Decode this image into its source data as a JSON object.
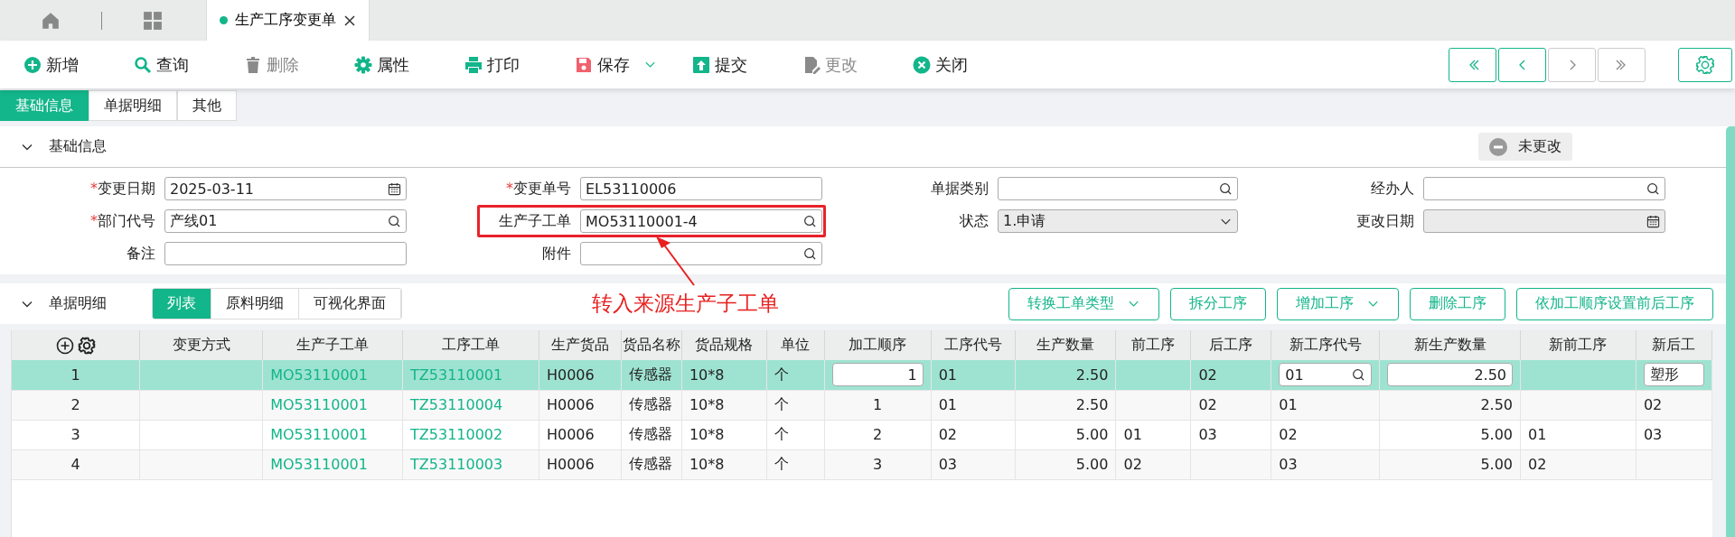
{
  "window_tabs": [
    {
      "kind": "home",
      "selected": false
    },
    {
      "kind": "apps",
      "selected": false
    },
    {
      "kind": "page",
      "label": "生产工序变更单",
      "selected": true,
      "closable": true
    }
  ],
  "toolbar": {
    "buttons": [
      {
        "label": "新增",
        "kind": "add",
        "disabled": false
      },
      {
        "label": "查询",
        "kind": "search",
        "disabled": false
      },
      {
        "label": "删除",
        "kind": "delete",
        "disabled": true
      },
      {
        "label": "属性",
        "kind": "gear",
        "disabled": false
      },
      {
        "label": "打印",
        "kind": "print",
        "disabled": false
      },
      {
        "label": "保存",
        "kind": "save",
        "disabled": false,
        "dropdown": true
      },
      {
        "label": "提交",
        "kind": "submit",
        "disabled": false
      },
      {
        "label": "更改",
        "kind": "edit",
        "disabled": true
      },
      {
        "label": "关闭",
        "kind": "close",
        "disabled": false
      }
    ],
    "nav": [
      {
        "kind": "first",
        "disabled": false
      },
      {
        "kind": "prev",
        "disabled": false
      },
      {
        "kind": "next",
        "disabled": true
      },
      {
        "kind": "last",
        "disabled": true
      }
    ]
  },
  "form_tabs": [
    {
      "label": "基础信息",
      "selected": true
    },
    {
      "label": "单据明细",
      "selected": false
    },
    {
      "label": "其他",
      "selected": false
    }
  ],
  "basic_section": {
    "title": "基础信息",
    "expanded": true,
    "status_badge": "未更改",
    "rows": [
      [
        {
          "required_mark": "*",
          "label": "变更日期",
          "kind": "date",
          "value": "2025-03-11"
        },
        {
          "required_mark": "*",
          "label": "变更单号",
          "kind": "text",
          "value": "EL53110006"
        },
        {
          "label": "单据类别",
          "kind": "lookup"
        },
        {
          "label": "经办人",
          "kind": "lookup"
        }
      ],
      [
        {
          "required_mark": "*",
          "label": "部门代号",
          "kind": "lookup",
          "value": "产线01"
        },
        {
          "label": "生产子工单",
          "kind": "lookup",
          "value": "MO53110001-4",
          "highlighted": true
        },
        {
          "label": "状态",
          "kind": "select",
          "value": "1.申请"
        },
        {
          "label": "更改日期",
          "kind": "date",
          "disabled": true
        }
      ],
      [
        {
          "label": "备注",
          "kind": "memo"
        },
        {
          "label": "附件",
          "kind": "lookup"
        }
      ]
    ]
  },
  "annotation": {
    "text": "转入来源生产子工单"
  },
  "detail_section": {
    "title": "单据明细",
    "expanded": true,
    "views": [
      {
        "label": "列表",
        "selected": true
      },
      {
        "label": "原料明细",
        "selected": false
      },
      {
        "label": "可视化界面",
        "selected": false
      }
    ],
    "actions": [
      {
        "label": "转换工单类型",
        "dropdown": true
      },
      {
        "label": "拆分工序",
        "dropdown": false
      },
      {
        "label": "增加工序",
        "dropdown": true
      },
      {
        "label": "删除工序",
        "dropdown": false
      },
      {
        "label": "依加工顺序设置前后工序",
        "dropdown": false
      }
    ]
  },
  "table": {
    "columns": [
      {
        "kind": "index"
      },
      {
        "label": "变更方式",
        "kind": "text"
      },
      {
        "label": "生产子工单",
        "kind": "link"
      },
      {
        "label": "工序工单",
        "kind": "link"
      },
      {
        "label": "生产货品",
        "kind": "text"
      },
      {
        "label": "货品名称",
        "kind": "text"
      },
      {
        "label": "货品规格",
        "kind": "text"
      },
      {
        "label": "单位",
        "kind": "text"
      },
      {
        "label": "加工顺序",
        "kind": "center",
        "editable": true
      },
      {
        "label": "工序代号",
        "kind": "text"
      },
      {
        "label": "生产数量",
        "kind": "number"
      },
      {
        "label": "前工序",
        "kind": "text"
      },
      {
        "label": "后工序",
        "kind": "text"
      },
      {
        "label": "新工序代号",
        "kind": "lookup",
        "editable": true
      },
      {
        "label": "新生产数量",
        "kind": "number",
        "editable": true
      },
      {
        "label": "新前工序",
        "kind": "text"
      },
      {
        "label": "新后工",
        "kind": "text",
        "editable": true
      }
    ],
    "rows": [
      {
        "selected": true,
        "cells": [
          "1",
          null,
          "MO53110001",
          "TZ53110001",
          "H0006",
          "传感器",
          "10*8",
          "个",
          "1",
          "01",
          "2.50",
          null,
          "02",
          "01",
          "2.50",
          null,
          "塑形"
        ]
      },
      {
        "selected": false,
        "cells": [
          "2",
          null,
          "MO53110001",
          "TZ53110004",
          "H0006",
          "传感器",
          "10*8",
          "个",
          "1",
          "01",
          "2.50",
          null,
          "02",
          "01",
          "2.50",
          null,
          "02"
        ]
      },
      {
        "selected": false,
        "cells": [
          "3",
          null,
          "MO53110001",
          "TZ53110002",
          "H0006",
          "传感器",
          "10*8",
          "个",
          "2",
          "02",
          "5.00",
          "01",
          "03",
          "02",
          "5.00",
          "01",
          "03"
        ]
      },
      {
        "selected": false,
        "cells": [
          "4",
          null,
          "MO53110001",
          "TZ53110003",
          "H0006",
          "传感器",
          "10*8",
          "个",
          "3",
          "03",
          "5.00",
          "02",
          null,
          "03",
          "5.00",
          "02",
          null
        ]
      }
    ]
  }
}
